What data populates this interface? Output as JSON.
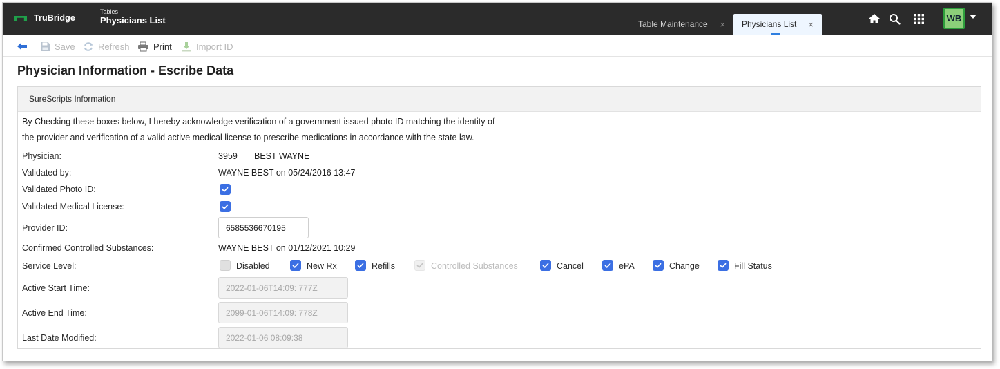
{
  "app": {
    "brand": "TruBridge"
  },
  "breadcrumb": {
    "section": "Tables",
    "title": "Physicians List"
  },
  "tabs": [
    {
      "label": "Table Maintenance",
      "active": false
    },
    {
      "label": "Physicians List",
      "active": true
    }
  ],
  "user": {
    "initials": "WB"
  },
  "toolbar": {
    "save": "Save",
    "refresh": "Refresh",
    "print": "Print",
    "import_id": "Import ID"
  },
  "page": {
    "title": "Physician Information - Escribe Data"
  },
  "panel": {
    "header": "SureScripts Information",
    "ack_line1": "By Checking these boxes below, I hereby acknowledge verification of a government issued photo ID matching the identity of",
    "ack_line2": "the provider and verification of a valid active medical license to prescribe medications in accordance with the state law."
  },
  "fields": {
    "physician_label": "Physician:",
    "physician_id": "3959",
    "physician_name": "BEST WAYNE",
    "validated_by_label": "Validated by:",
    "validated_by_value": "WAYNE BEST on 05/24/2016 13:47",
    "photo_id_label": "Validated Photo ID:",
    "photo_id_checked": true,
    "license_label": "Validated Medical License:",
    "license_checked": true,
    "provider_id_label": "Provider ID:",
    "provider_id_value": "6585536670195",
    "controlled_label": "Confirmed Controlled Substances:",
    "controlled_value": "WAYNE BEST on 01/12/2021 10:29",
    "service_level_label": "Service Level:",
    "active_start_label": "Active Start Time:",
    "active_start_value": "2022-01-06T14:09: 777Z",
    "active_end_label": "Active End Time:",
    "active_end_value": "2099-01-06T14:09: 778Z",
    "last_modified_label": "Last Date Modified:",
    "last_modified_value": "2022-01-06 08:09:38"
  },
  "service_levels": [
    {
      "label": "Disabled",
      "checked": false,
      "enabled": true
    },
    {
      "label": "New Rx",
      "checked": true,
      "enabled": true
    },
    {
      "label": "Refills",
      "checked": true,
      "enabled": true
    },
    {
      "label": "Controlled Substances",
      "checked": true,
      "enabled": false
    },
    {
      "label": "Cancel",
      "checked": true,
      "enabled": true
    },
    {
      "label": "ePA",
      "checked": true,
      "enabled": true
    },
    {
      "label": "Change",
      "checked": true,
      "enabled": true
    },
    {
      "label": "Fill Status",
      "checked": true,
      "enabled": true
    }
  ],
  "colors": {
    "topbar": "#2b2b2b",
    "brand_green": "#1fa04a",
    "checkbox": "#3b6fe3",
    "active_tab": "#eef6ff"
  }
}
